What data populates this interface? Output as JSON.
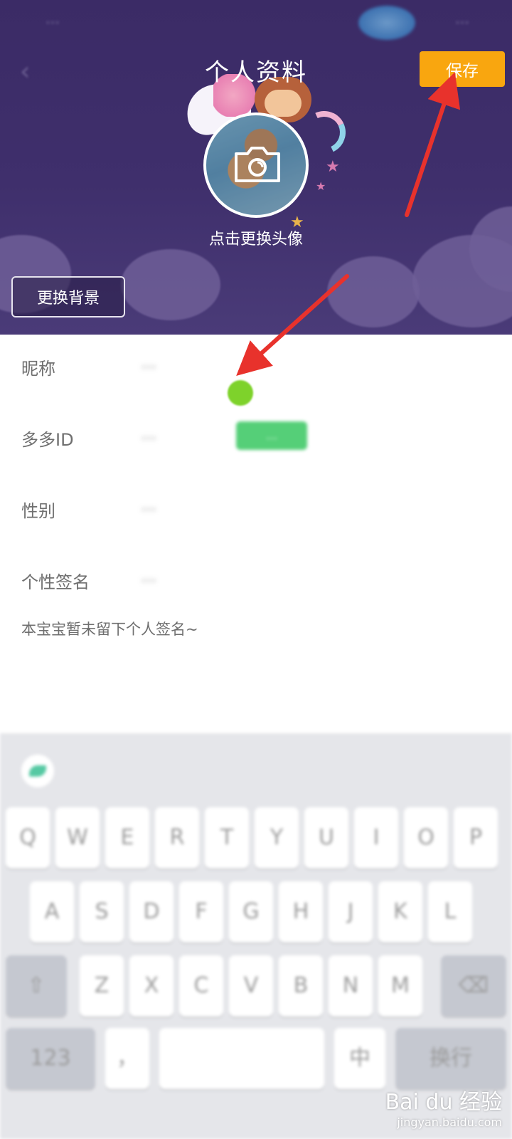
{
  "status_bar": {
    "left_text": "…",
    "right_text": "…"
  },
  "header": {
    "title": "个人资料",
    "save_label": "保存",
    "avatar_caption": "点击更换头像",
    "change_background_label": "更换背景"
  },
  "form": {
    "rows": [
      {
        "label": "昵称",
        "value": "…"
      },
      {
        "label": "多多ID",
        "value": "…",
        "badge": "…"
      },
      {
        "label": "性别",
        "value": "…"
      },
      {
        "label": "个性签名",
        "value": "…"
      }
    ],
    "signature_text": "本宝宝暂未留下个人签名~"
  },
  "keyboard": {
    "row1": [
      "Q",
      "W",
      "E",
      "R",
      "T",
      "Y",
      "U",
      "I",
      "O",
      "P"
    ],
    "row2": [
      "A",
      "S",
      "D",
      "F",
      "G",
      "H",
      "J",
      "K",
      "L"
    ],
    "row3": [
      "⇧",
      "Z",
      "X",
      "C",
      "V",
      "B",
      "N",
      "M",
      "⌫"
    ],
    "row4": [
      "123",
      "，",
      "",
      "中",
      "换行"
    ]
  },
  "watermark": {
    "brand": "Bai du 经验",
    "url": "jingyan.baidu.com"
  },
  "colors": {
    "header_bg": "#3b2b66",
    "save_button": "#f9a60f",
    "annotation_arrow": "#e8322c",
    "id_badge": "#55cf78",
    "cursor_dot": "#7ed22b"
  }
}
